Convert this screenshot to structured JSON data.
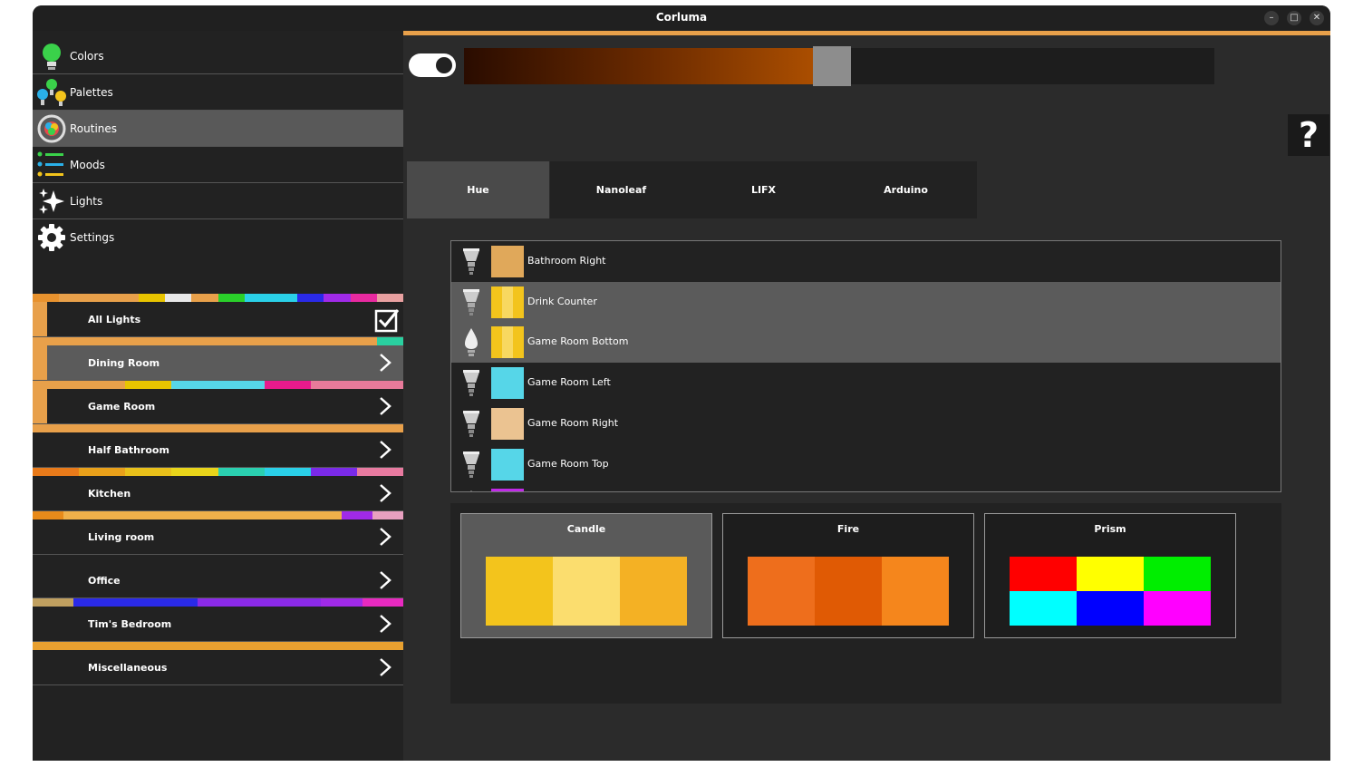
{
  "window": {
    "title": "Corluma",
    "minimize_label": "–",
    "maximize_label": "□",
    "close_label": "✕"
  },
  "nav": [
    {
      "label": "Colors",
      "icon": "bulb-icon"
    },
    {
      "label": "Palettes",
      "icon": "palettes-icon"
    },
    {
      "label": "Routines",
      "icon": "routines-icon"
    },
    {
      "label": "Moods",
      "icon": "moods-icon"
    },
    {
      "label": "Lights",
      "icon": "sparkle-icon"
    },
    {
      "label": "Settings",
      "icon": "gear-icon"
    }
  ],
  "rooms": [
    {
      "label": "All Lights",
      "control": "checkbox",
      "checked": true,
      "strip": [
        "#e8922e",
        "#e8a04a",
        "#e8a04a",
        "#e8a04a",
        "#e8c400",
        "#e8e8e8",
        "#e8a04a",
        "#2ad02a",
        "#2ad0e8",
        "#2ad0e8",
        "#2a2ae8",
        "#a02ae8",
        "#e82aa0",
        "#e8a0a0"
      ]
    },
    {
      "label": "Dining Room",
      "control": "chevron",
      "strip": [
        "#e8a04a",
        "#e8a04a",
        "#e8a04a",
        "#e8a04a",
        "#e8a04a",
        "#e8a04a",
        "#e8a04a",
        "#e8a04a",
        "#e8a04a",
        "#e8a04a",
        "#e8a04a",
        "#e8a04a",
        "#e8a04a",
        "#2ad0a0"
      ]
    },
    {
      "label": "Game Room",
      "control": "chevron",
      "strip": [
        "#e8a04a",
        "#e8a04a",
        "#e8c400",
        "#56d6e8",
        "#56d6e8",
        "#e81a8c",
        "#e87a9a",
        "#e87a9a"
      ]
    },
    {
      "label": "Half Bathroom",
      "control": "chevron",
      "strip": [
        "#e8a04a"
      ]
    },
    {
      "label": "Kitchen",
      "control": "chevron",
      "strip": [
        "#e87a1a",
        "#e8a01a",
        "#e8c01a",
        "#e8d41a",
        "#2ad0b0",
        "#2ad0e8",
        "#7a2ae8",
        "#e87aa0"
      ]
    },
    {
      "label": "Living room",
      "control": "chevron",
      "strip": [
        "#e88a1a",
        "#f0b04a",
        "#f0b04a",
        "#f0b04a",
        "#f0b04a",
        "#f0b04a",
        "#f0b04a",
        "#f0b04a",
        "#f0b04a",
        "#f0b04a",
        "#a02ae8",
        "#e8a0c0"
      ]
    },
    {
      "label": "Office",
      "control": "chevron",
      "strip": [
        "#222222"
      ]
    },
    {
      "label": "Tim's Bedroom",
      "control": "chevron",
      "strip": [
        "#c0a060",
        "#2a2ae8",
        "#2a2ae8",
        "#2a2ae8",
        "#8a2ae8",
        "#8a2ae8",
        "#8a2ae8",
        "#a02ae8",
        "#e82ac0"
      ]
    },
    {
      "label": "Miscellaneous",
      "control": "chevron",
      "strip": [
        "#e8a030"
      ]
    }
  ],
  "brightness": {
    "on": true,
    "value_pct": 49
  },
  "tabs": [
    {
      "label": "Hue",
      "active": true
    },
    {
      "label": "Nanoleaf",
      "active": false
    },
    {
      "label": "LIFX",
      "active": false
    },
    {
      "label": "Arduino",
      "active": false
    }
  ],
  "help": {
    "label": "?"
  },
  "lights": [
    {
      "name": "Bathroom Right",
      "bulb": "spot",
      "colors": [
        "#e0a85a"
      ],
      "selected": false
    },
    {
      "name": "Drink Counter",
      "bulb": "spot",
      "colors": [
        "#f3c41c",
        "#f8d860",
        "#f3c41c"
      ],
      "selected": true
    },
    {
      "name": "Game Room Bottom",
      "bulb": "candle",
      "colors": [
        "#f3c41c",
        "#f8d860",
        "#f3c41c"
      ],
      "selected": true
    },
    {
      "name": "Game Room Left",
      "bulb": "spot",
      "colors": [
        "#56d6e8"
      ],
      "selected": false
    },
    {
      "name": "Game Room Right",
      "bulb": "spot",
      "colors": [
        "#ebc391"
      ],
      "selected": false
    },
    {
      "name": "Game Room Top",
      "bulb": "spot",
      "colors": [
        "#56d6e8"
      ],
      "selected": false
    },
    {
      "name": "",
      "bulb": "candle",
      "colors": [
        "#c02ae8"
      ],
      "selected": false
    }
  ],
  "palettes": [
    {
      "name": "Candle",
      "cols": 3,
      "rows": 1,
      "colors": [
        "#f3c41c",
        "#fbdd6e",
        "#f4b124"
      ],
      "selected": true
    },
    {
      "name": "Fire",
      "cols": 3,
      "rows": 1,
      "colors": [
        "#ee6e1c",
        "#e05a04",
        "#f5861c"
      ],
      "selected": false
    },
    {
      "name": "Prism",
      "cols": 3,
      "rows": 2,
      "colors": [
        "#ff0000",
        "#ffff00",
        "#00ee00",
        "#00ffff",
        "#0000ff",
        "#ff00ff"
      ],
      "selected": false
    }
  ]
}
